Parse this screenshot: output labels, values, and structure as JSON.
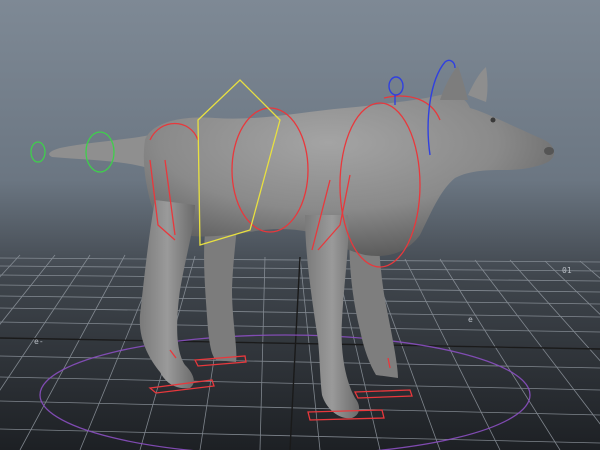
{
  "viewport": {
    "background_top": "#7e8995",
    "background_bottom": "#1d2024"
  },
  "model": {
    "subject": "wolf",
    "body_color": "#8c8c8c"
  },
  "rig_colors": {
    "fk_controls": "#e8383c",
    "root_control": "#e8e040",
    "tail_controls": "#3fcf4c",
    "head_controls": "#3040e0",
    "world_circle": "#8a4fc0"
  },
  "grid_labels": {
    "right_far": "01",
    "left_near": "e-",
    "center": "e"
  }
}
